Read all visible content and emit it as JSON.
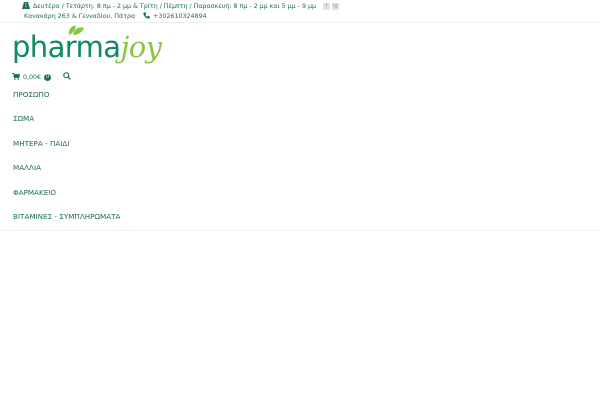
{
  "topbar": {
    "hours": "Δευτέρα / Τετάρτη: 8 πμ - 2 μμ & Τρίτη / Πέμπτη / Παρασκευή: 8 πμ - 2 μμ και 5 μμ - 9 μμ",
    "address": "Κανακάρη 263 & Γενναδίου, Πάτρα",
    "phone": "+302610324894",
    "social": [
      "f",
      "ig"
    ]
  },
  "logo": {
    "part1": "pharma",
    "part2": "joy"
  },
  "cart": {
    "amount": "0,00€",
    "count": "0"
  },
  "menu": {
    "items": [
      {
        "label": "ΠΡΟΣΩΠΟ"
      },
      {
        "label": "ΣΩΜΑ"
      },
      {
        "label": "ΜΗΤΕΡΑ - ΠΑΙΔΙ"
      },
      {
        "label": "ΜΑΛΛΙΑ"
      },
      {
        "label": "ΦΑΡΜΑΚΕΙΟ"
      },
      {
        "label": "ΒΙΤΑΜΙΝΕΣ - ΣΥΜΠΛΗΡΩΜΑΤΑ"
      }
    ]
  },
  "colors": {
    "brand_dark": "#1d6b5a",
    "logo_green": "#0f8a63",
    "logo_lime": "#8cc540"
  }
}
